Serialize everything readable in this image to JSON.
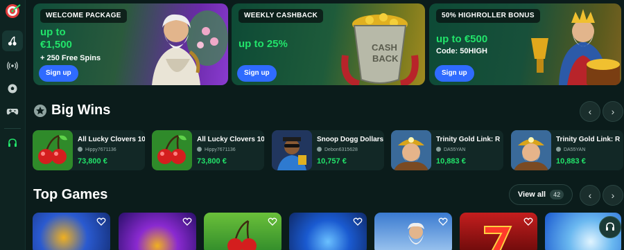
{
  "colors": {
    "accent_green": "#22e36a",
    "signup_blue": "#2f6bff",
    "background": "#0b1c1b"
  },
  "sidebar": {
    "logo": "dartboard-logo-icon",
    "items": [
      {
        "icon": "cherries-icon",
        "active": true
      },
      {
        "icon": "live-broadcast-icon"
      },
      {
        "icon": "soccer-ball-icon"
      },
      {
        "icon": "gamepad-icon"
      },
      {
        "icon": "headset-support-icon"
      }
    ]
  },
  "promos": [
    {
      "tag": "WELCOME PACKAGE",
      "headline_line1": "up to",
      "headline_line2": "€1,500",
      "sub": "+ 250 Free Spins",
      "button": "Sign up",
      "art": "zeus-character"
    },
    {
      "tag": "WEEKLY CASHBACK",
      "headline_line1": "up to 25%",
      "button": "Sign up",
      "art": "cashback-pot"
    },
    {
      "tag": "50% HIGHROLLER BONUS",
      "headline_line1": "up to €500",
      "sub": "Code: 50HIGH",
      "button": "Sign up",
      "art": "king-treasure"
    }
  ],
  "big_wins": {
    "title": "Big Wins",
    "icon": "star-icon",
    "items": [
      {
        "game": "All Lucky Clovers 10",
        "user": "Hippy7671136",
        "amount": "73,800 €",
        "thumb": "cherries"
      },
      {
        "game": "All Lucky Clovers 10",
        "user": "Hippy7671136",
        "amount": "73,800 €",
        "thumb": "cherries"
      },
      {
        "game": "Snoop Dogg Dollars",
        "user": "Debon6315628",
        "amount": "10,757 €",
        "thumb": "snoop"
      },
      {
        "game": "Trinity Gold Link: R",
        "user": "DA55YAN",
        "amount": "10,883 €",
        "thumb": "miner"
      },
      {
        "game": "Trinity Gold Link: R",
        "user": "DA55YAN",
        "amount": "10,883 €",
        "thumb": "miner"
      }
    ]
  },
  "top_games": {
    "title": "Top Games",
    "view_all_label": "View all",
    "view_all_count": "42",
    "tiles": [
      "lightning",
      "diamond",
      "cherries",
      "blue-gem",
      "zeus",
      "seven",
      "blue-swirl"
    ]
  }
}
